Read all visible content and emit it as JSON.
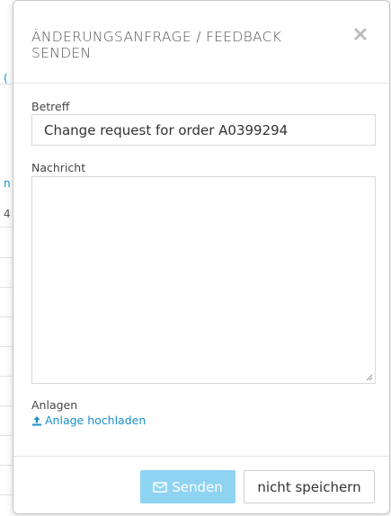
{
  "background": {
    "fragment_1": "(",
    "fragment_2": "n",
    "fragment_3": "4"
  },
  "modal": {
    "title": "ÄNDERUNGSANFRAGE / FEEDBACK SENDEN",
    "close_icon": "close-icon",
    "subject": {
      "label": "Betreff",
      "value": "Change request for order A0399294"
    },
    "message": {
      "label": "Nachricht",
      "value": ""
    },
    "attachments": {
      "label": "Anlagen",
      "upload_label": "Anlage hochladen",
      "upload_icon": "upload-icon"
    },
    "footer": {
      "send_label": "Senden",
      "send_icon": "envelope-icon",
      "cancel_label": "nicht speichern"
    }
  },
  "colors": {
    "accent": "#1a8fc9",
    "send_button": "#8fd3f2"
  }
}
